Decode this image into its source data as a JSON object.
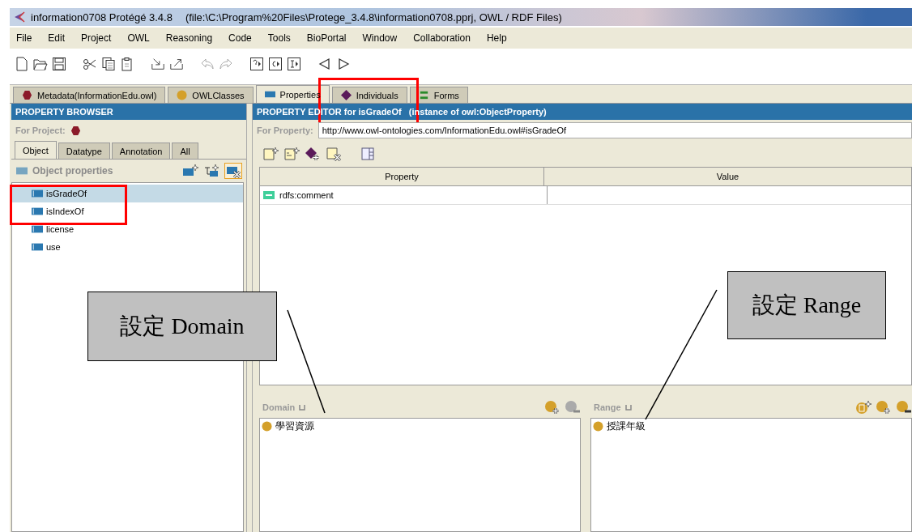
{
  "window": {
    "title": "information0708  Protégé 3.4.8",
    "path": "(file:\\C:\\Program%20Files\\Protege_3.4.8\\information0708.pprj, OWL / RDF Files)"
  },
  "menu": [
    "File",
    "Edit",
    "Project",
    "OWL",
    "Reasoning",
    "Code",
    "Tools",
    "BioPortal",
    "Window",
    "Collaboration",
    "Help"
  ],
  "tabs": [
    {
      "label": "Metadata(InformationEdu.owl)",
      "kind": "ontology",
      "selected": false
    },
    {
      "label": "OWLClasses",
      "kind": "class",
      "selected": false
    },
    {
      "label": "Properties",
      "kind": "property",
      "selected": true
    },
    {
      "label": "Individuals",
      "kind": "individual",
      "selected": false
    },
    {
      "label": "Forms",
      "kind": "form",
      "selected": false
    }
  ],
  "browser": {
    "title": "PROPERTY BROWSER",
    "for_project": "For Project:",
    "subtabs": [
      {
        "label": "Object",
        "selected": true
      },
      {
        "label": "Datatype",
        "selected": false
      },
      {
        "label": "Annotation",
        "selected": false
      },
      {
        "label": "All",
        "selected": false
      }
    ],
    "tree_header": "Object properties",
    "items": [
      {
        "label": "isGradeOf",
        "selected": true
      },
      {
        "label": "isIndexOf",
        "selected": false
      },
      {
        "label": "license",
        "selected": false
      },
      {
        "label": "use",
        "selected": false
      }
    ]
  },
  "editor": {
    "title": "PROPERTY EDITOR for isGradeOf   (instance of owl:ObjectProperty)",
    "for_property": "For Property:",
    "uri": "http://www.owl-ontologies.com/InformationEdu.owl#isGradeOf",
    "columns": [
      "Property",
      "Value"
    ],
    "rows": [
      {
        "property": "rdfs:comment"
      }
    ],
    "domain": {
      "label": "Domain",
      "items": [
        "學習資源"
      ]
    },
    "range": {
      "label": "Range",
      "items": [
        "授課年級"
      ]
    }
  },
  "callouts": [
    {
      "text": "設定 Domain"
    },
    {
      "text": "設定 Range"
    }
  ]
}
